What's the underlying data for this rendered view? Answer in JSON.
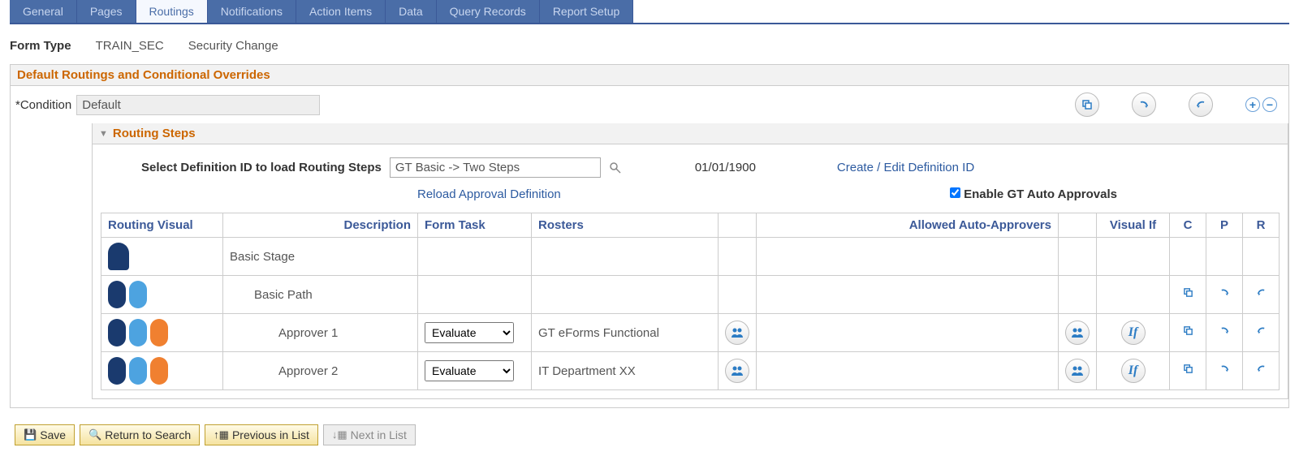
{
  "tabs": [
    {
      "label": "General",
      "active": false
    },
    {
      "label": "Pages",
      "active": false
    },
    {
      "label": "Routings",
      "active": true
    },
    {
      "label": "Notifications",
      "active": false
    },
    {
      "label": "Action Items",
      "active": false
    },
    {
      "label": "Data",
      "active": false
    },
    {
      "label": "Query Records",
      "active": false
    },
    {
      "label": "Report Setup",
      "active": false
    }
  ],
  "form_type": {
    "label": "Form Type",
    "code": "TRAIN_SEC",
    "desc": "Security Change"
  },
  "section_title": "Default Routings and Conditional Overrides",
  "condition": {
    "label": "Condition",
    "value": "Default"
  },
  "routing_steps": {
    "title": "Routing Steps",
    "def": {
      "label": "Select Definition ID to load Routing Steps",
      "value": "GT Basic -> Two Steps",
      "date": "01/01/1900",
      "create_link": "Create / Edit Definition ID"
    },
    "reload_link": "Reload Approval Definition",
    "enable_auto": {
      "label": "Enable GT Auto Approvals",
      "checked": true
    },
    "columns": {
      "visual": "Routing Visual",
      "desc": "Description",
      "task": "Form Task",
      "rosters": "Rosters",
      "auto": "Allowed Auto-Approvers",
      "vif": "Visual If",
      "c": "C",
      "p": "P",
      "r": "R"
    },
    "task_options": [
      "Evaluate"
    ],
    "rows": [
      {
        "level": 0,
        "desc": "Basic Stage",
        "task": "",
        "roster": "",
        "roster_btn": false,
        "auto_btn": false,
        "vif": false,
        "cpr": false
      },
      {
        "level": 1,
        "desc": "Basic Path",
        "task": "",
        "roster": "",
        "roster_btn": false,
        "auto_btn": false,
        "vif": false,
        "cpr": true
      },
      {
        "level": 2,
        "desc": "Approver 1",
        "task": "Evaluate",
        "roster": "GT eForms Functional",
        "roster_btn": true,
        "auto_btn": true,
        "vif": true,
        "cpr": true
      },
      {
        "level": 2,
        "desc": "Approver 2",
        "task": "Evaluate",
        "roster": "IT Department XX",
        "roster_btn": true,
        "auto_btn": true,
        "vif": true,
        "cpr": true
      }
    ]
  },
  "buttons": {
    "save": "Save",
    "return": "Return to Search",
    "prev": "Previous in List",
    "next": "Next in List"
  },
  "icons": {
    "if_label": "If"
  }
}
